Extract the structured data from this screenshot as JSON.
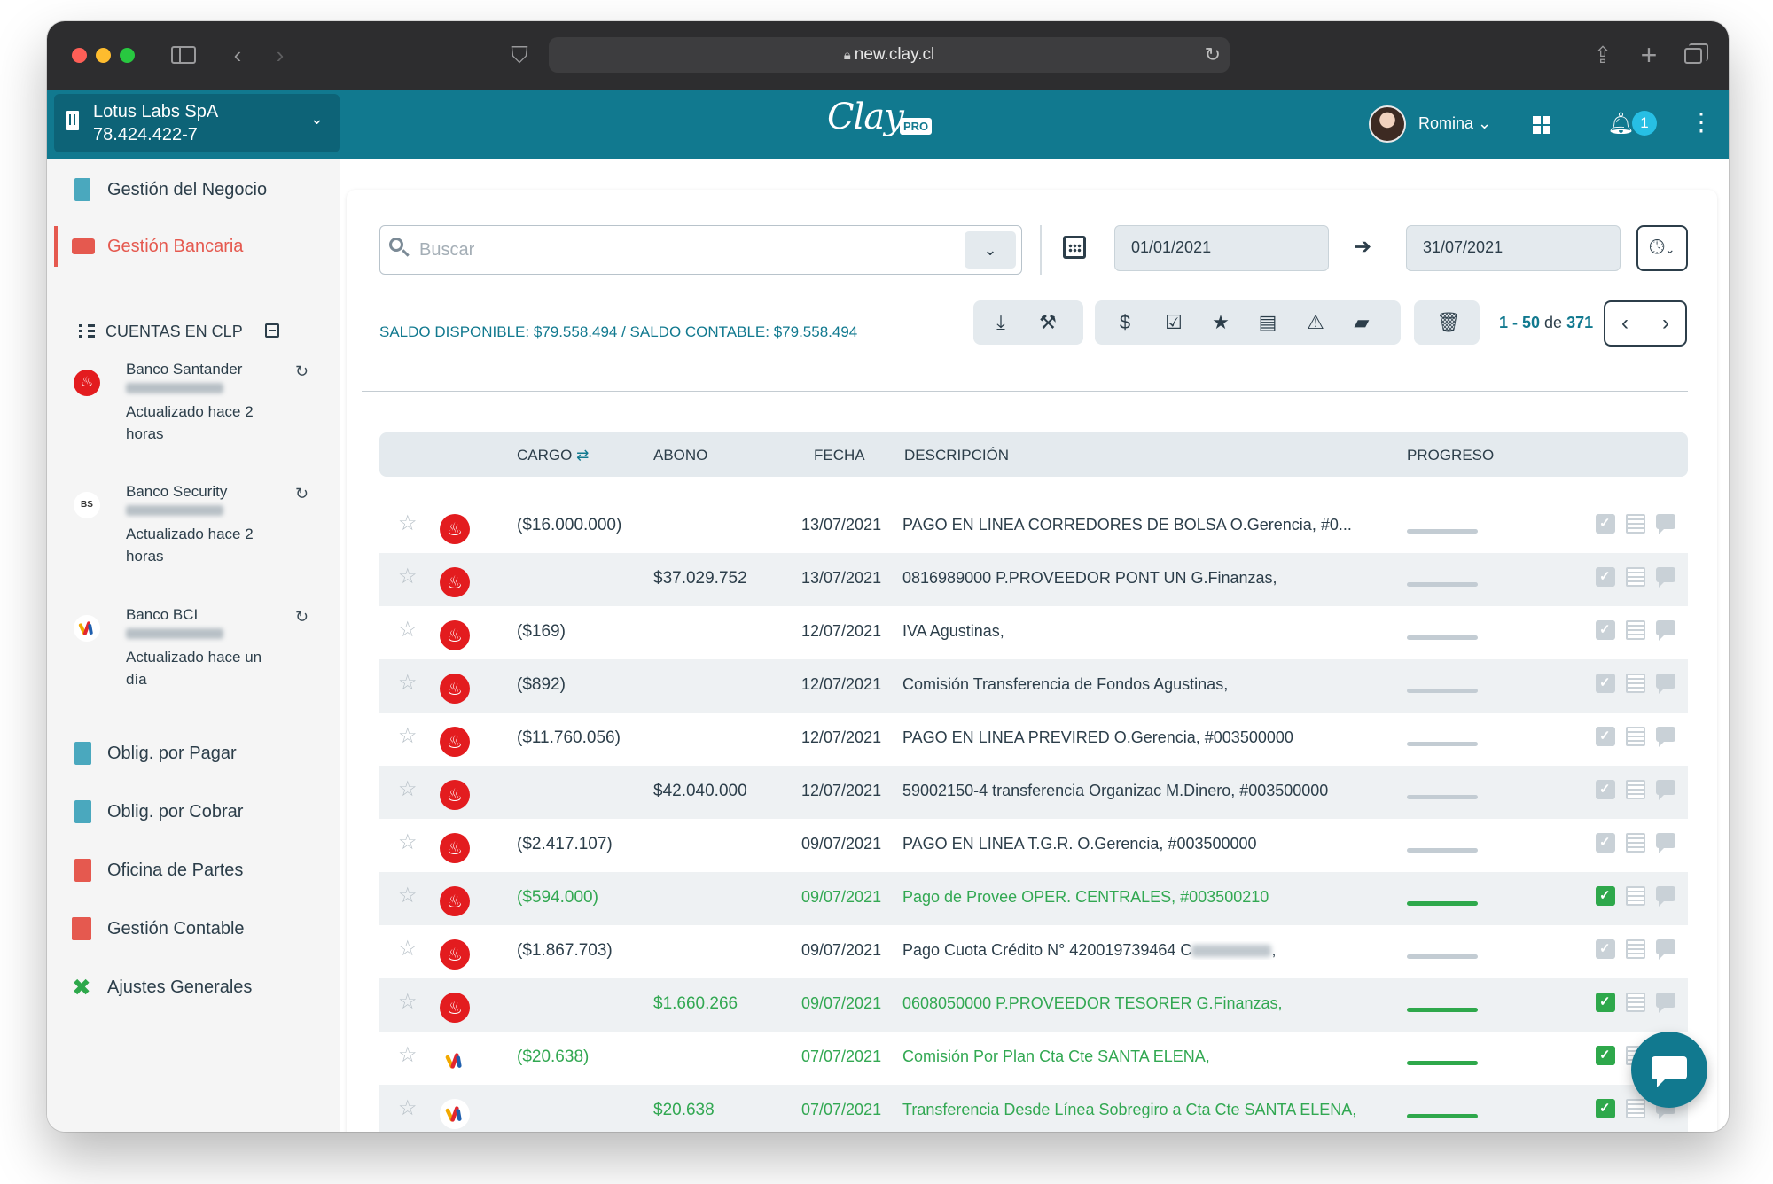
{
  "browser": {
    "url": "new.clay.cl"
  },
  "header": {
    "company_name": "Lotus Labs SpA",
    "company_rut": "78.424.422-7",
    "logo": "Clay",
    "logo_badge": "PRO",
    "user_name": "Romina",
    "notifications": "1"
  },
  "sidebar": {
    "items": [
      {
        "label": "Gestión del Negocio",
        "icon": "building-icon"
      },
      {
        "label": "Gestión Bancaria",
        "icon": "briefcase-icon",
        "active": true
      },
      {
        "label": "Oblig. por Pagar",
        "icon": "document-dollar-icon"
      },
      {
        "label": "Oblig. por Cobrar",
        "icon": "document-dollar-icon"
      },
      {
        "label": "Oficina de Partes",
        "icon": "document-upload-icon"
      },
      {
        "label": "Gestión Contable",
        "icon": "calculator-icon"
      },
      {
        "label": "Ajustes Generales",
        "icon": "tools-icon"
      }
    ],
    "cuentas_label": "CUENTAS EN CLP",
    "banks": [
      {
        "name": "Banco Santander",
        "updated": "Actualizado hace 2 horas"
      },
      {
        "name": "Banco Security",
        "logo_text": "BS",
        "updated": "Actualizado hace 2 horas"
      },
      {
        "name": "Banco BCI",
        "updated": "Actualizado hace un día"
      }
    ]
  },
  "filters": {
    "search_placeholder": "Buscar",
    "date_from": "01/01/2021",
    "date_to": "31/07/2021"
  },
  "summary": {
    "saldo_text": "SALDO DISPONIBLE: $79.558.494 / SALDO CONTABLE: $79.558.494",
    "pager_range": "1 - 50",
    "pager_of": "de",
    "pager_total": "371"
  },
  "table": {
    "headers": {
      "cargo": "CARGO",
      "abono": "ABONO",
      "fecha": "FECHA",
      "descripcion": "DESCRIPCIÓN",
      "progreso": "PROGRESO"
    },
    "rows": [
      {
        "bank": "santander",
        "cargo": "($16.000.000)",
        "abono": "",
        "fecha": "13/07/2021",
        "descripcion": "PAGO EN LINEA CORREDORES DE BOLSA O.Gerencia, #0...",
        "done": false
      },
      {
        "bank": "santander",
        "cargo": "",
        "abono": "$37.029.752",
        "fecha": "13/07/2021",
        "descripcion": "0816989000 P.PROVEEDOR PONT UN G.Finanzas,",
        "done": false
      },
      {
        "bank": "santander",
        "cargo": "($169)",
        "abono": "",
        "fecha": "12/07/2021",
        "descripcion": "IVA Agustinas,",
        "done": false
      },
      {
        "bank": "santander",
        "cargo": "($892)",
        "abono": "",
        "fecha": "12/07/2021",
        "descripcion": "Comisión Transferencia de Fondos Agustinas,",
        "done": false
      },
      {
        "bank": "santander",
        "cargo": "($11.760.056)",
        "abono": "",
        "fecha": "12/07/2021",
        "descripcion": "PAGO EN LINEA PREVIRED O.Gerencia, #003500000",
        "done": false
      },
      {
        "bank": "santander",
        "cargo": "",
        "abono": "$42.040.000",
        "fecha": "12/07/2021",
        "descripcion": "59002150-4 transferencia Organizac M.Dinero, #003500000",
        "done": false
      },
      {
        "bank": "santander",
        "cargo": "($2.417.107)",
        "abono": "",
        "fecha": "09/07/2021",
        "descripcion": "PAGO EN LINEA T.G.R. O.Gerencia, #003500000",
        "done": false
      },
      {
        "bank": "santander",
        "cargo": "($594.000)",
        "abono": "",
        "fecha": "09/07/2021",
        "descripcion": "Pago de Provee OPER. CENTRALES, #003500210",
        "done": true
      },
      {
        "bank": "santander",
        "cargo": "($1.867.703)",
        "abono": "",
        "fecha": "09/07/2021",
        "descripcion": "Pago Cuota Crédito N° 420019739464 C",
        "desc_suffix": ",",
        "blur": true,
        "done": false
      },
      {
        "bank": "santander",
        "cargo": "",
        "abono": "$1.660.266",
        "fecha": "09/07/2021",
        "descripcion": "0608050000 P.PROVEEDOR TESORER G.Finanzas,",
        "done": true
      },
      {
        "bank": "bci",
        "cargo": "($20.638)",
        "abono": "",
        "fecha": "07/07/2021",
        "descripcion": "Comisión Por Plan Cta Cte SANTA ELENA,",
        "done": true
      },
      {
        "bank": "bci",
        "cargo": "",
        "abono": "$20.638",
        "fecha": "07/07/2021",
        "descripcion": "Transferencia Desde Línea Sobregiro a Cta Cte SANTA ELENA,",
        "done": true
      }
    ]
  },
  "colors": {
    "header_teal": "#11798f",
    "active_red": "#e5594f",
    "done_green": "#32a852"
  }
}
